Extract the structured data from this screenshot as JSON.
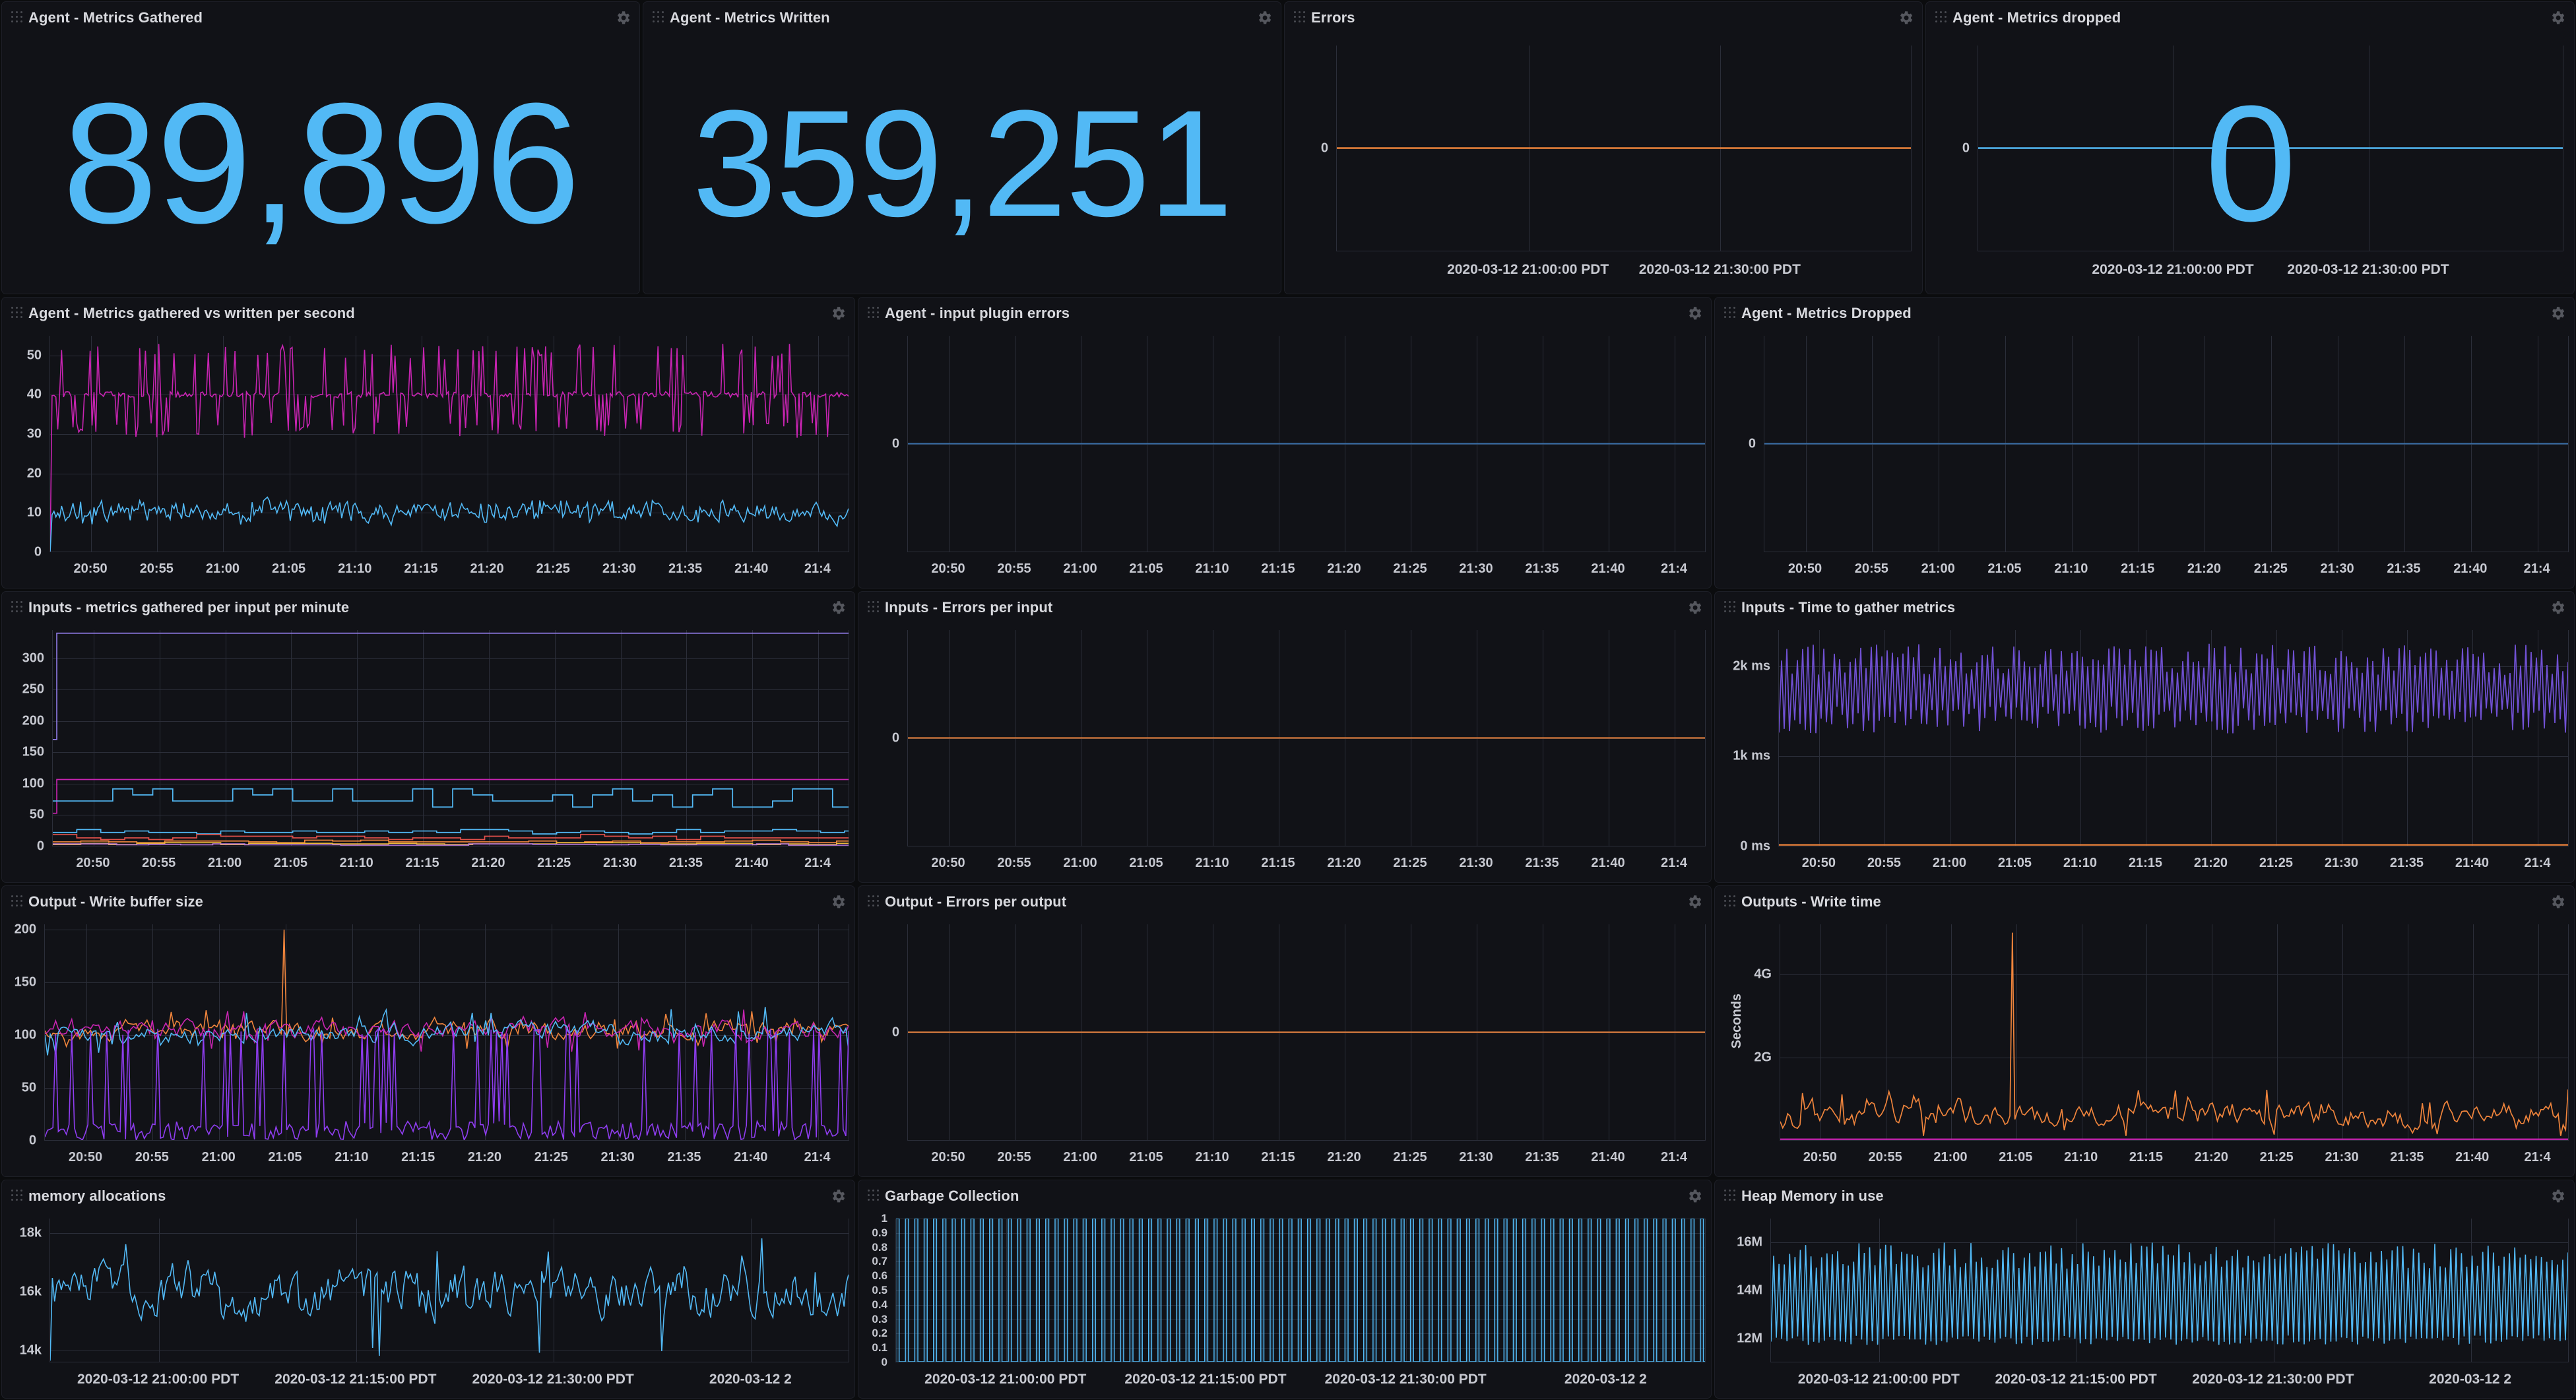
{
  "theme": {
    "page_bg": "#0b0c0e",
    "panel_bg": "#111217",
    "panel_border": "#1d1f27",
    "grid": "#2b2e39",
    "text": "#d8d9de",
    "stat_blue": "#52b9f5",
    "series_blue": "#52b9f5",
    "series_magenta": "#c724b1",
    "series_orange": "#ef843c",
    "series_purple": "#7151d4",
    "series_red": "#e0504a",
    "series_yellow": "#eab839"
  },
  "panels": [
    {
      "id": "agent-metrics-gathered",
      "title": "Agent - Metrics Gathered",
      "type": "stat",
      "value": "89,896",
      "gear": true
    },
    {
      "id": "agent-metrics-written",
      "title": "Agent - Metrics Written",
      "type": "stat",
      "value": "359,251",
      "gear": true
    },
    {
      "id": "errors",
      "title": "Errors",
      "type": "stat-graph",
      "value": "",
      "gear": true,
      "yticks": [
        "0"
      ],
      "xticks": [
        "2020-03-12 21:00:00 PDT",
        "2020-03-12 21:30:00 PDT"
      ]
    },
    {
      "id": "agent-metrics-dropped-stat",
      "title": "Agent - Metrics dropped",
      "type": "stat-graph",
      "value": "0",
      "gear": true,
      "yticks": [
        "0"
      ],
      "xticks": [
        "2020-03-12 21:00:00 PDT",
        "2020-03-12 21:30:00 PDT"
      ]
    },
    {
      "id": "agent-gathered-vs-written",
      "title": "Agent - Metrics gathered vs written per second",
      "type": "graph",
      "gear": true,
      "yticks": [
        "50",
        "40",
        "30",
        "20",
        "10",
        "0"
      ],
      "xticks": [
        "20:50",
        "20:55",
        "21:00",
        "21:05",
        "21:10",
        "21:15",
        "21:20",
        "21:25",
        "21:30",
        "21:35",
        "21:40",
        "21:4"
      ]
    },
    {
      "id": "agent-input-plugin-errors",
      "title": "Agent - input plugin errors",
      "type": "graph",
      "gear": true,
      "yticks": [
        "0"
      ],
      "xticks": [
        "20:50",
        "20:55",
        "21:00",
        "21:05",
        "21:10",
        "21:15",
        "21:20",
        "21:25",
        "21:30",
        "21:35",
        "21:40",
        "21:4"
      ]
    },
    {
      "id": "agent-metrics-dropped-graph",
      "title": "Agent - Metrics Dropped",
      "type": "graph",
      "gear": true,
      "yticks": [
        "0"
      ],
      "xticks": [
        "20:50",
        "20:55",
        "21:00",
        "21:05",
        "21:10",
        "21:15",
        "21:20",
        "21:25",
        "21:30",
        "21:35",
        "21:40",
        "21:4"
      ]
    },
    {
      "id": "inputs-metrics-gathered-per-input",
      "title": "Inputs - metrics gathered per input per minute",
      "type": "graph",
      "gear": true,
      "yticks": [
        "300",
        "250",
        "200",
        "150",
        "100",
        "50",
        "0"
      ],
      "xticks": [
        "20:50",
        "20:55",
        "21:00",
        "21:05",
        "21:10",
        "21:15",
        "21:20",
        "21:25",
        "21:30",
        "21:35",
        "21:40",
        "21:4"
      ]
    },
    {
      "id": "inputs-errors-per-input",
      "title": "Inputs - Errors per input",
      "type": "graph",
      "gear": true,
      "yticks": [
        "0"
      ],
      "xticks": [
        "20:50",
        "20:55",
        "21:00",
        "21:05",
        "21:10",
        "21:15",
        "21:20",
        "21:25",
        "21:30",
        "21:35",
        "21:40",
        "21:4"
      ]
    },
    {
      "id": "inputs-time-to-gather-metrics",
      "title": "Inputs - Time to gather metrics",
      "type": "graph",
      "gear": true,
      "yticks": [
        "2k ms",
        "1k ms",
        "0 ms"
      ],
      "xticks": [
        "20:50",
        "20:55",
        "21:00",
        "21:05",
        "21:10",
        "21:15",
        "21:20",
        "21:25",
        "21:30",
        "21:35",
        "21:40",
        "21:4"
      ]
    },
    {
      "id": "output-write-buffer-size",
      "title": "Output - Write buffer size",
      "type": "graph",
      "gear": true,
      "yticks": [
        "200",
        "150",
        "100",
        "50",
        "0"
      ],
      "xticks": [
        "20:50",
        "20:55",
        "21:00",
        "21:05",
        "21:10",
        "21:15",
        "21:20",
        "21:25",
        "21:30",
        "21:35",
        "21:40",
        "21:4"
      ]
    },
    {
      "id": "output-errors-per-output",
      "title": "Output - Errors per output",
      "type": "graph",
      "gear": true,
      "yticks": [
        "0"
      ],
      "xticks": [
        "20:50",
        "20:55",
        "21:00",
        "21:05",
        "21:10",
        "21:15",
        "21:20",
        "21:25",
        "21:30",
        "21:35",
        "21:40",
        "21:4"
      ]
    },
    {
      "id": "outputs-write-time",
      "title": "Outputs - Write time",
      "type": "graph",
      "gear": true,
      "axis_label": "Seconds",
      "yticks": [
        "4G",
        "2G"
      ],
      "xticks": [
        "20:50",
        "20:55",
        "21:00",
        "21:05",
        "21:10",
        "21:15",
        "21:20",
        "21:25",
        "21:30",
        "21:35",
        "21:40",
        "21:4"
      ]
    },
    {
      "id": "memory-allocations",
      "title": "memory allocations",
      "type": "graph",
      "gear": true,
      "yticks": [
        "18k",
        "16k",
        "14k"
      ],
      "xticks": [
        "2020-03-12 21:00:00 PDT",
        "2020-03-12 21:15:00 PDT",
        "2020-03-12 21:30:00 PDT",
        "2020-03-12 2"
      ]
    },
    {
      "id": "garbage-collection",
      "title": "Garbage Collection",
      "type": "graph",
      "gear": true,
      "yticks": [
        "1",
        "0.9",
        "0.8",
        "0.7",
        "0.6",
        "0.5",
        "0.4",
        "0.3",
        "0.2",
        "0.1",
        "0"
      ],
      "xticks": [
        "2020-03-12 21:00:00 PDT",
        "2020-03-12 21:15:00 PDT",
        "2020-03-12 21:30:00 PDT",
        "2020-03-12 2"
      ]
    },
    {
      "id": "heap-memory-in-use",
      "title": "Heap Memory in use",
      "type": "graph",
      "gear": true,
      "yticks": [
        "16M",
        "14M",
        "12M"
      ],
      "xticks": [
        "2020-03-12 21:00:00 PDT",
        "2020-03-12 21:15:00 PDT",
        "2020-03-12 21:30:00 PDT",
        "2020-03-12 2"
      ]
    }
  ],
  "chart_data": [
    {
      "id": "errors",
      "type": "line",
      "title": "Errors",
      "ylabel": "",
      "xlabel": "",
      "yticks": [
        0
      ],
      "xticklabels": [
        "2020-03-12 21:00:00 PDT",
        "2020-03-12 21:30:00 PDT"
      ],
      "series": [
        {
          "name": "errors",
          "color": "#ef843c",
          "constant": 0
        }
      ],
      "ylim": [
        -1,
        1
      ],
      "grid": true,
      "legend": "none"
    },
    {
      "id": "agent-metrics-dropped-stat",
      "type": "line",
      "title": "Agent - Metrics dropped",
      "ylabel": "",
      "xlabel": "",
      "yticks": [
        0
      ],
      "xticklabels": [
        "2020-03-12 21:00:00 PDT",
        "2020-03-12 21:30:00 PDT"
      ],
      "series": [
        {
          "name": "dropped",
          "color": "#52b9f5",
          "constant": 0
        }
      ],
      "ylim": [
        -1,
        1
      ],
      "grid": true,
      "legend": "none",
      "overlay_value": "0"
    },
    {
      "id": "agent-gathered-vs-written",
      "type": "line",
      "title": "Agent - Metrics gathered vs written per second",
      "ylabel": "",
      "xlabel": "",
      "yticks": [
        0,
        10,
        20,
        30,
        40,
        50
      ],
      "ylim": [
        0,
        55
      ],
      "xticklabels": [
        "20:50",
        "20:55",
        "21:00",
        "21:05",
        "21:10",
        "21:15",
        "21:20",
        "21:25",
        "21:30",
        "21:35",
        "21:40",
        "21:4"
      ],
      "series": [
        {
          "name": "metrics written per second",
          "color": "#c724b1",
          "baseline": 40,
          "spike_min": 27,
          "spike_max": 54
        },
        {
          "name": "metrics gathered per second",
          "color": "#52b9f5",
          "baseline": 10,
          "spike_min": 7,
          "spike_max": 13
        }
      ],
      "grid": true,
      "legend": "none"
    },
    {
      "id": "agent-input-plugin-errors",
      "type": "line",
      "title": "Agent - input plugin errors",
      "yticks": [
        0
      ],
      "ylim": [
        -1,
        1
      ],
      "xticklabels": [
        "20:50",
        "20:55",
        "21:00",
        "21:05",
        "21:10",
        "21:15",
        "21:20",
        "21:25",
        "21:30",
        "21:35",
        "21:40",
        "21:4"
      ],
      "series": [
        {
          "name": "errors",
          "color": "#3a6fa8",
          "constant": 0
        }
      ],
      "grid": true,
      "legend": "none"
    },
    {
      "id": "agent-metrics-dropped-graph",
      "type": "line",
      "title": "Agent - Metrics Dropped",
      "yticks": [
        0
      ],
      "ylim": [
        -1,
        1
      ],
      "xticklabels": [
        "20:50",
        "20:55",
        "21:00",
        "21:05",
        "21:10",
        "21:15",
        "21:20",
        "21:25",
        "21:30",
        "21:35",
        "21:40",
        "21:4"
      ],
      "series": [
        {
          "name": "dropped",
          "color": "#3a6fa8",
          "constant": 0
        }
      ],
      "grid": true,
      "legend": "none"
    },
    {
      "id": "inputs-metrics-gathered-per-input",
      "type": "line",
      "title": "Inputs - metrics gathered per input per minute",
      "yticks": [
        0,
        50,
        100,
        150,
        200,
        250,
        300
      ],
      "ylim": [
        0,
        345
      ],
      "xticklabels": [
        "20:50",
        "20:55",
        "21:00",
        "21:05",
        "21:10",
        "21:15",
        "21:20",
        "21:25",
        "21:30",
        "21:35",
        "21:40",
        "21:4"
      ],
      "series": [
        {
          "name": "input-a",
          "color": "#8f7ae5",
          "level": 340,
          "start": 170
        },
        {
          "name": "input-b",
          "color": "#c724b1",
          "level": 106,
          "start": 52
        },
        {
          "name": "input-c",
          "color": "#52b9f5",
          "level": 78,
          "step_min": 62,
          "step_max": 91
        },
        {
          "name": "input-d",
          "color": "#52b9f5",
          "level": 23,
          "step_min": 19,
          "step_max": 26
        },
        {
          "name": "input-e",
          "color": "#e0504a",
          "level": 14,
          "step_min": 10,
          "step_max": 18
        },
        {
          "name": "input-f",
          "color": "#ef843c",
          "level": 7,
          "step_min": 5,
          "step_max": 9
        },
        {
          "name": "input-g",
          "color": "#eab839",
          "level": 3,
          "step_min": 2,
          "step_max": 5
        }
      ],
      "grid": true,
      "legend": "none"
    },
    {
      "id": "inputs-errors-per-input",
      "type": "line",
      "title": "Inputs - Errors per input",
      "yticks": [
        0
      ],
      "ylim": [
        -1,
        1
      ],
      "xticklabels": [
        "20:50",
        "20:55",
        "21:00",
        "21:05",
        "21:10",
        "21:15",
        "21:20",
        "21:25",
        "21:30",
        "21:35",
        "21:40",
        "21:4"
      ],
      "series": [
        {
          "name": "errors",
          "color": "#ef843c",
          "constant": 0
        }
      ],
      "grid": true,
      "legend": "none"
    },
    {
      "id": "inputs-time-to-gather-metrics",
      "type": "line",
      "title": "Inputs - Time to gather metrics",
      "yticks": [
        0,
        1000,
        2000
      ],
      "ytickunits": "ms",
      "ylim": [
        0,
        2400
      ],
      "xticklabels": [
        "20:50",
        "20:55",
        "21:00",
        "21:05",
        "21:10",
        "21:15",
        "21:20",
        "21:25",
        "21:30",
        "21:35",
        "21:40",
        "21:4"
      ],
      "series": [
        {
          "name": "gather time",
          "color": "#7151d4",
          "osc_min": 1250,
          "osc_max": 2250
        },
        {
          "name": "gather time (fast inputs)",
          "color": "#ef843c",
          "constant": 10
        }
      ],
      "grid": true,
      "legend": "none"
    },
    {
      "id": "output-write-buffer-size",
      "type": "line",
      "title": "Output - Write buffer size",
      "yticks": [
        0,
        50,
        100,
        150,
        200
      ],
      "ylim": [
        0,
        205
      ],
      "xticklabels": [
        "20:50",
        "20:55",
        "21:00",
        "21:05",
        "21:10",
        "21:15",
        "21:20",
        "21:25",
        "21:30",
        "21:35",
        "21:40",
        "21:4"
      ],
      "series": [
        {
          "name": "buffer-a",
          "color": "#ef843c",
          "baseline": 105,
          "peak": 200
        },
        {
          "name": "buffer-b",
          "color": "#c724b1",
          "baseline": 104
        },
        {
          "name": "buffer-c",
          "color": "#52b9f5",
          "baseline": 103
        },
        {
          "name": "buffer-d",
          "color": "#8f3df0",
          "baseline": 8,
          "spike_to": 100
        }
      ],
      "grid": true,
      "legend": "none"
    },
    {
      "id": "output-errors-per-output",
      "type": "line",
      "title": "Output - Errors per output",
      "yticks": [
        0
      ],
      "ylim": [
        -1,
        1
      ],
      "xticklabels": [
        "20:50",
        "20:55",
        "21:00",
        "21:05",
        "21:10",
        "21:15",
        "21:20",
        "21:25",
        "21:30",
        "21:35",
        "21:40",
        "21:4"
      ],
      "series": [
        {
          "name": "errors",
          "color": "#ef843c",
          "constant": 0
        }
      ],
      "grid": true,
      "legend": "none"
    },
    {
      "id": "outputs-write-time",
      "type": "line",
      "title": "Outputs - Write time",
      "ylabel": "Seconds",
      "yticks": [
        2000000000,
        4000000000
      ],
      "ytickformat": [
        "2G",
        "4G"
      ],
      "ylim": [
        0,
        5200000000
      ],
      "xticklabels": [
        "20:50",
        "20:55",
        "21:00",
        "21:05",
        "21:10",
        "21:15",
        "21:20",
        "21:25",
        "21:30",
        "21:35",
        "21:40",
        "21:4"
      ],
      "series": [
        {
          "name": "write time",
          "color": "#ef843c",
          "baseline": 500000000,
          "peak": 5000000000
        },
        {
          "name": "write time (fast)",
          "color": "#c724b1",
          "constant": 20000000
        }
      ],
      "grid": true,
      "legend": "none"
    },
    {
      "id": "memory-allocations",
      "type": "line",
      "title": "memory allocations",
      "yticks": [
        14000,
        16000,
        18000
      ],
      "ytickformat": [
        "14k",
        "16k",
        "18k"
      ],
      "ylim": [
        13600,
        18500
      ],
      "xticklabels": [
        "2020-03-12 21:00:00 PDT",
        "2020-03-12 21:15:00 PDT",
        "2020-03-12 21:30:00 PDT",
        "2020-03-12 2"
      ],
      "series": [
        {
          "name": "mallocs",
          "color": "#52b9f5",
          "mean": 16000,
          "min": 13900,
          "max": 18200
        }
      ],
      "grid": true,
      "legend": "none"
    },
    {
      "id": "garbage-collection",
      "type": "line",
      "title": "Garbage Collection",
      "yticks": [
        0,
        0.1,
        0.2,
        0.3,
        0.4,
        0.5,
        0.6,
        0.7,
        0.8,
        0.9,
        1
      ],
      "ylim": [
        0,
        1
      ],
      "xticklabels": [
        "2020-03-12 21:00:00 PDT",
        "2020-03-12 21:15:00 PDT",
        "2020-03-12 21:30:00 PDT",
        "2020-03-12 2"
      ],
      "series": [
        {
          "name": "gc runs",
          "color": "#52b9f5",
          "pulse_low": 0,
          "pulse_high": 1,
          "filled": true
        }
      ],
      "grid": true,
      "legend": "none"
    },
    {
      "id": "heap-memory-in-use",
      "type": "line",
      "title": "Heap Memory in use",
      "yticks": [
        12000000,
        14000000,
        16000000
      ],
      "ytickformat": [
        "12M",
        "14M",
        "16M"
      ],
      "ylim": [
        11000000,
        17000000
      ],
      "xticklabels": [
        "2020-03-12 21:00:00 PDT",
        "2020-03-12 21:15:00 PDT",
        "2020-03-12 21:30:00 PDT",
        "2020-03-12 2"
      ],
      "series": [
        {
          "name": "heap in use",
          "color": "#52b9f5",
          "min": 11300000,
          "max": 16500000
        }
      ],
      "grid": true,
      "legend": "none"
    }
  ]
}
